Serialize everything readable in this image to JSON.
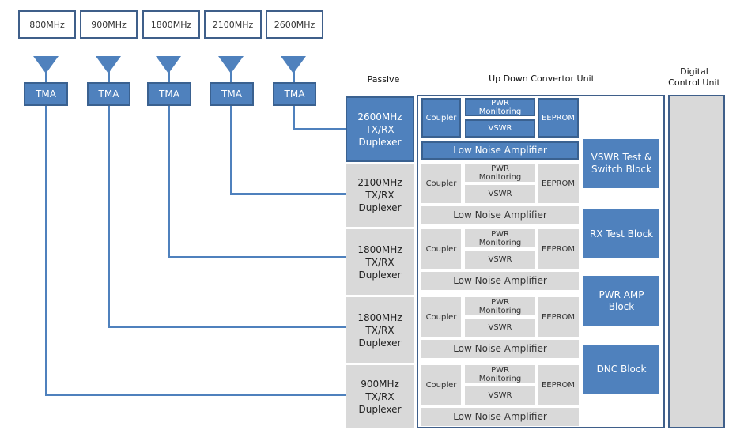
{
  "bands": [
    "800MHz",
    "900MHz",
    "1800MHz",
    "2100MHz",
    "2600MHz"
  ],
  "tma_label": "TMA",
  "passive": {
    "title": "Passive",
    "duplexers": [
      {
        "freq": "2600MHz",
        "type": "TX/RX",
        "name": "Duplexer",
        "highlighted": true
      },
      {
        "freq": "2100MHz",
        "type": "TX/RX",
        "name": "Duplexer",
        "highlighted": false
      },
      {
        "freq": "1800MHz",
        "type": "TX/RX",
        "name": "Duplexer",
        "highlighted": false
      },
      {
        "freq": "1800MHz",
        "type": "TX/RX",
        "name": "Duplexer",
        "highlighted": false
      },
      {
        "freq": "900MHz",
        "type": "TX/RX",
        "name": "Duplexer",
        "highlighted": false
      }
    ]
  },
  "udc": {
    "title": "Up Down Convertor Unit",
    "module": {
      "coupler": "Coupler",
      "pwr1": "PWR",
      "pwr2": "Monitoring",
      "vswr": "VSWR",
      "eeprom": "EEPROM",
      "lna": "Low Noise Amplifier"
    },
    "blocks": [
      [
        "VSWR Test &",
        "Switch Block"
      ],
      [
        "RX Test Block",
        ""
      ],
      [
        "PWR AMP",
        "Block"
      ],
      [
        "DNC Block",
        ""
      ]
    ]
  },
  "dcu": {
    "title1": "Digital",
    "title2": "Control Unit"
  },
  "colors": {
    "accent": "#4f81bd",
    "border": "#3f5f8a",
    "inactive": "#d9d9d9"
  }
}
